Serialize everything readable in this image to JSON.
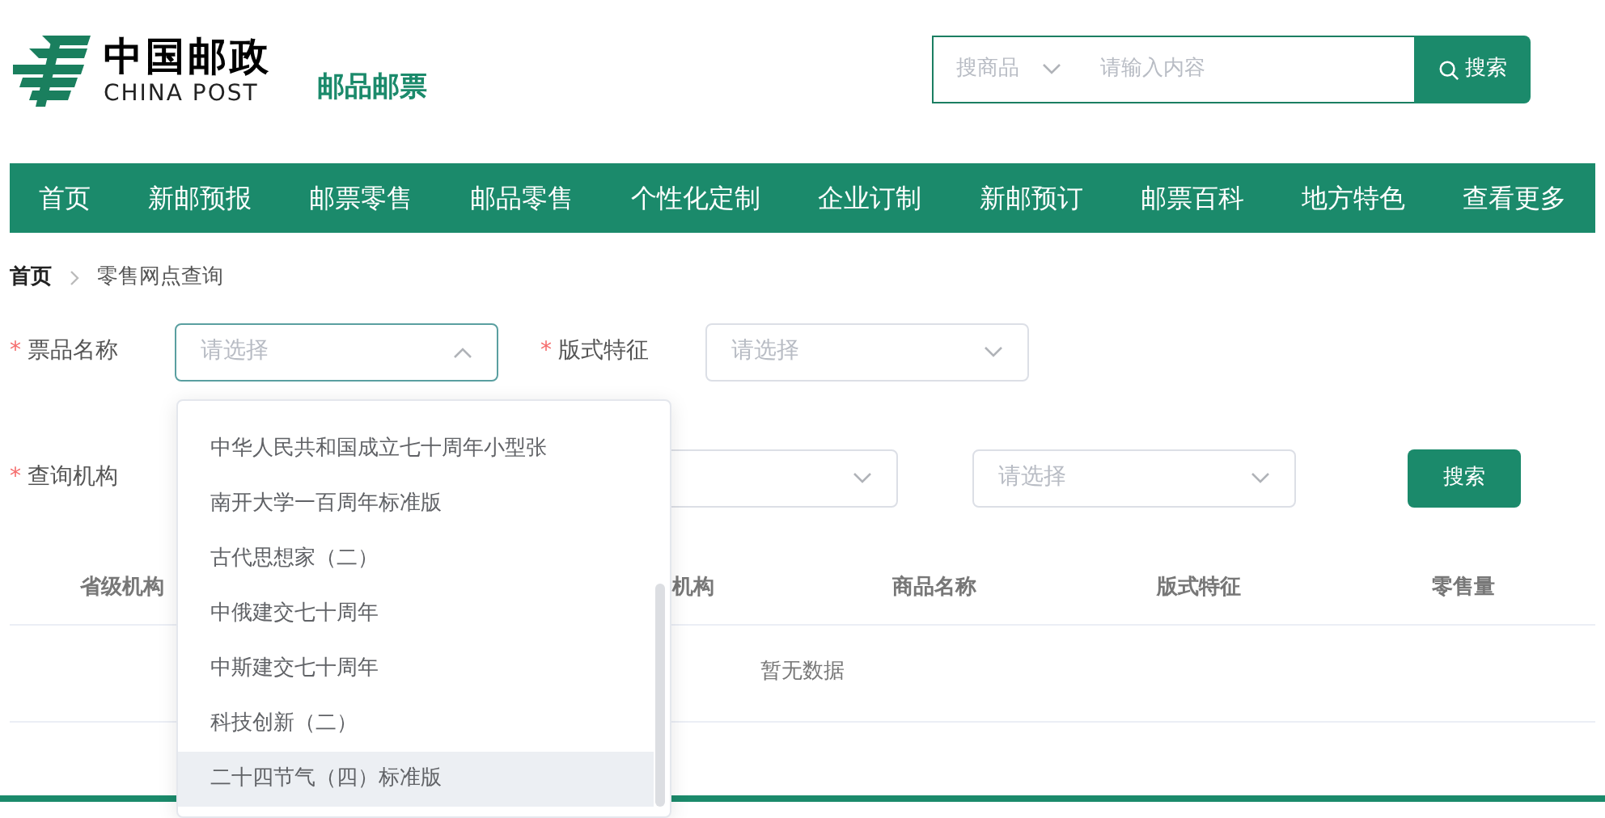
{
  "brand": {
    "name_cn": "中国邮政",
    "name_en": "CHINA POST",
    "section": "邮品邮票"
  },
  "search": {
    "category": "搜商品",
    "placeholder": "请输入内容",
    "button": "搜索"
  },
  "nav": [
    {
      "label": "首页"
    },
    {
      "label": "新邮预报"
    },
    {
      "label": "邮票零售"
    },
    {
      "label": "邮品零售"
    },
    {
      "label": "个性化定制"
    },
    {
      "label": "企业订制"
    },
    {
      "label": "新邮预订"
    },
    {
      "label": "邮票百科"
    },
    {
      "label": "地方特色"
    },
    {
      "label": "查看更多"
    }
  ],
  "breadcrumb": [
    "首页",
    "零售网点查询"
  ],
  "filters": [
    {
      "label": "票品名称",
      "mark": "*",
      "selects": [
        {
          "placeholder": "请选择",
          "open": true
        },
        {
          "label": "版式特征",
          "mark": "*",
          "placeholder": "请选择",
          "open": false
        }
      ]
    },
    {
      "label": "查询机构",
      "mark": "*",
      "selects": [
        {
          "open": false
        },
        {
          "placeholder": "请选择",
          "open": false
        }
      ],
      "button": "搜索"
    }
  ],
  "table": {
    "columns": [
      "省级机构",
      "机构",
      "商品名称",
      "版式特征",
      "零售量"
    ],
    "empty": "暂无数据"
  },
  "dropdown": {
    "options": [
      {
        "label": "中华人民共和国成立七十周年小型张",
        "highlighted": false
      },
      {
        "label": "南开大学一百周年标准版",
        "highlighted": false
      },
      {
        "label": "古代思想家（二）",
        "highlighted": false
      },
      {
        "label": "中俄建交七十周年",
        "highlighted": false
      },
      {
        "label": "中斯建交七十周年",
        "highlighted": false
      },
      {
        "label": "科技创新（二）",
        "highlighted": false
      },
      {
        "label": "二十四节气（四）标准版",
        "highlighted": true
      }
    ]
  }
}
